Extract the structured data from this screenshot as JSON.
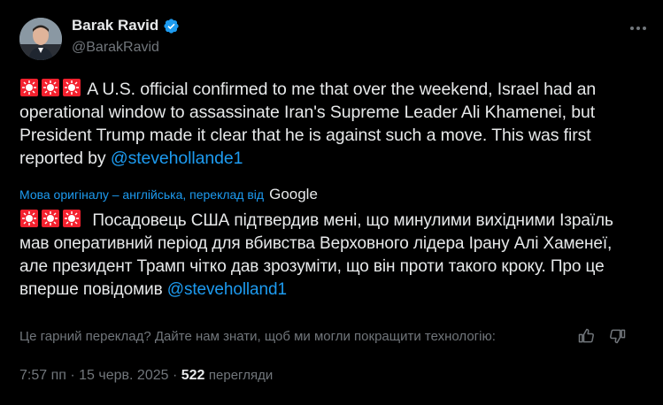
{
  "author": {
    "name": "Barak Ravid",
    "handle": "@BarakRavid",
    "verified": true,
    "avatar_icon": "profile-photo"
  },
  "tweet": {
    "emoji_prefix": "🚨🚨🚨",
    "text_main": "A U.S. official confirmed to me that over the weekend, Israel had an operational window to assassinate Iran's Supreme Leader Ali Khamenei, but President Trump made it clear that he is against such a move. This was first reported by ",
    "mention": "@stevehollande1"
  },
  "translation": {
    "notice": "Мова оригіналу – англійська, переклад від",
    "provider": "Google",
    "text_main": "Посадовець США підтвердив мені, що минулими вихідними Ізраїль мав оперативний період для вбивства Верховного лідера Ірану Алі Хаменеї, але президент Трамп чітко дав зрозуміти, що він проти такого кроку. Про це вперше повідомив ",
    "mention": "@steveholland1",
    "feedback_prompt": "Це гарний переклад? Дайте нам знати, щоб ми могли покращити технологію:"
  },
  "meta": {
    "time": "7:57 пп",
    "separator": "·",
    "date": "15 черв. 2025",
    "views_count": "522",
    "views_label": "перегляди"
  },
  "colors": {
    "background": "#000000",
    "text": "#e7e9ea",
    "muted": "#71767b",
    "accent": "#1d9bf0",
    "siren": "#f4212e"
  }
}
